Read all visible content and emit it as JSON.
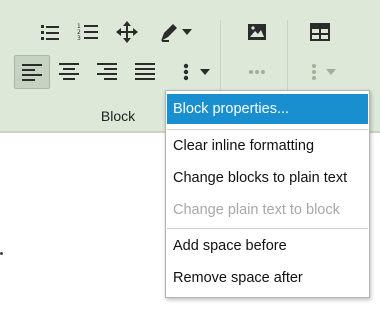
{
  "toolbar": {
    "group_label": "Block",
    "icons": {
      "bullet_list": "bullet-list-icon",
      "numbered_list": "numbered-list-icon",
      "move": "move-arrows-icon",
      "pen": "pen-icon",
      "image": "image-icon",
      "table": "table-icon",
      "align_left": "align-left-icon",
      "align_center": "align-center-icon",
      "align_right": "align-right-icon",
      "justify": "align-justify-icon",
      "more": "vertical-ellipsis-icon",
      "more_disabled_1": "horizontal-ellipsis-icon",
      "more_disabled_2": "vertical-ellipsis-icon"
    },
    "colors": {
      "ribbon": "#dde8d8",
      "icon": "#2b2b2b",
      "disabled_icon": "#9fb09a"
    }
  },
  "menu": {
    "items": [
      {
        "label": "Block properties...",
        "state": "selected"
      },
      {
        "label": "Clear inline formatting",
        "state": "normal"
      },
      {
        "label": "Change blocks to plain text",
        "state": "normal"
      },
      {
        "label": "Change plain text to block",
        "state": "disabled"
      },
      {
        "label": "Add space before",
        "state": "normal"
      },
      {
        "label": "Remove space after",
        "state": "normal"
      }
    ],
    "colors": {
      "highlight": "#1a8fd0",
      "disabled_text": "#a8a8a8"
    }
  }
}
